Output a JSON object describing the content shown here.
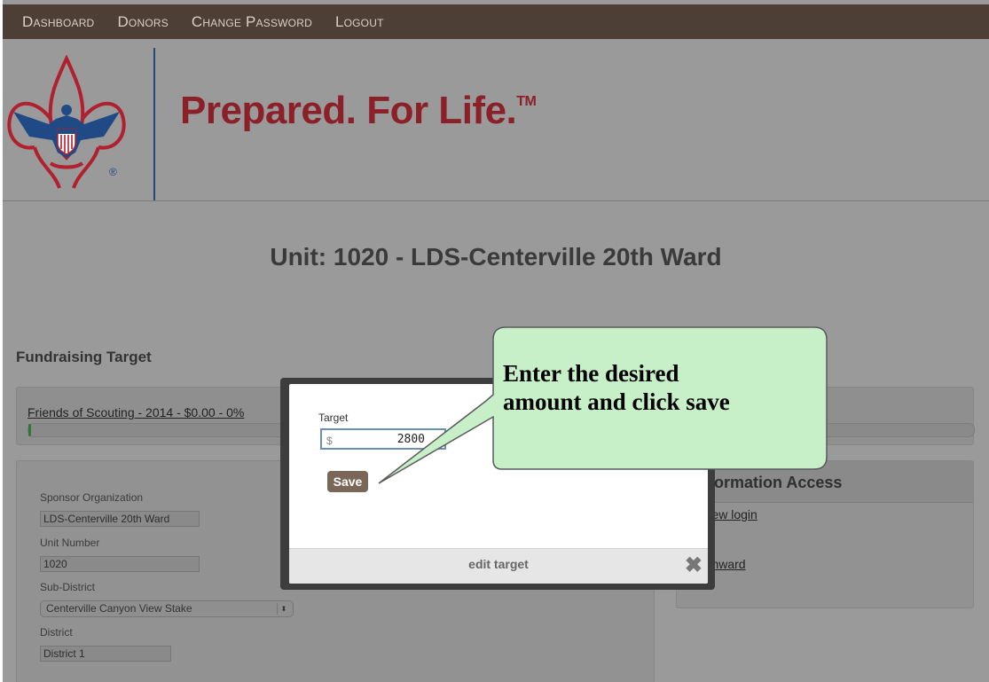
{
  "nav": {
    "items": [
      "Dashboard",
      "Donors",
      "Change Password",
      "Logout"
    ]
  },
  "header": {
    "tagline": "Prepared. For Life.",
    "tagline_mark": "TM",
    "logo_mark": "®"
  },
  "colors": {
    "nav_bg": "#4d3f36",
    "tagline": "#8b2029",
    "save_button": "#7a6758",
    "callout_fill": "#c8f0c8",
    "logo_red": "#b0202e",
    "logo_blue": "#1f4a86"
  },
  "unit": {
    "title": "Unit: 1020 - LDS-Centerville 20th Ward"
  },
  "fundraising": {
    "title": "Fundraising Target",
    "campaign_link": "Friends of Scouting - 2014 - $0.00 - 0%",
    "progress": 0
  },
  "sponsor": {
    "org_label": "Sponsor Organization",
    "org_value": "LDS-Centerville 20th Ward",
    "unit_number_label": "Unit Number",
    "unit_number_value": "1020",
    "subdistrict_label": "Sub-District",
    "subdistrict_value": "Centerville Canyon View Stake",
    "district_label": "District",
    "district_value": "District 1"
  },
  "access": {
    "title": "Information Access",
    "new_login_link": "a new login",
    "username_link": "20thward"
  },
  "modal": {
    "field_label": "Target",
    "currency": "$",
    "value": "2800",
    "save_label": "Save",
    "footer_title": "edit target",
    "close_glyph": "✖"
  },
  "callout": {
    "line1": "Enter the desired",
    "line2": "amount and click save"
  }
}
